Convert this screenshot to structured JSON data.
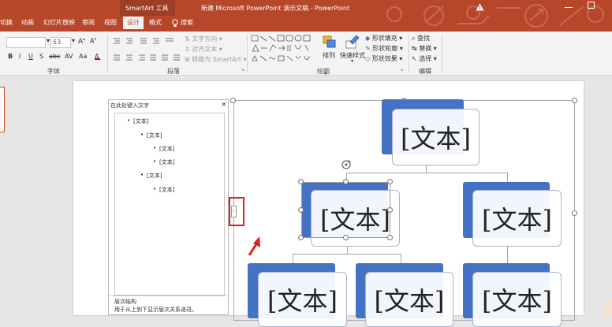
{
  "titlebar": {
    "context_tab": "SmartArt 工具",
    "doc_title": "新建 Microsoft PowerPoint 演示文稿  -  PowerPoint",
    "warning_icon": "warning-icon",
    "tabs": [
      "切换",
      "动画",
      "幻灯片放映",
      "审阅",
      "视图",
      "设计",
      "格式"
    ],
    "search_label": "搜索",
    "accent": "#b7472a"
  },
  "ribbon": {
    "font_size_value": "53",
    "groups": {
      "font": "字体",
      "paragraph": "段落",
      "drawing": "绘图",
      "editing": "编辑"
    },
    "paragraph_items": [
      "文字方向",
      "对齐文本",
      "转换为 SmartArt"
    ],
    "arrange_label": "排列",
    "quick_styles_label": "快速样式",
    "shape_fill": "形状填充",
    "shape_outline": "形状轮廓",
    "shape_effects": "形状效果",
    "find": "查找",
    "replace": "替换",
    "select": "选择"
  },
  "text_pane": {
    "title": "在此处键入文字",
    "close_icon": "close-icon",
    "items": [
      {
        "level": 1,
        "text": "[文本]"
      },
      {
        "level": 2,
        "text": "[文本]"
      },
      {
        "level": 3,
        "text": "[文本]"
      },
      {
        "level": 3,
        "text": "[文本]"
      },
      {
        "level": 2,
        "text": "[文本]"
      },
      {
        "level": 3,
        "text": "[文本]"
      }
    ],
    "footer_title": "层次结构",
    "footer_desc": "用于从上到下显示层次关系递进。"
  },
  "diagram": {
    "node_text": "[文本]",
    "fill_color": "#4472c4"
  }
}
